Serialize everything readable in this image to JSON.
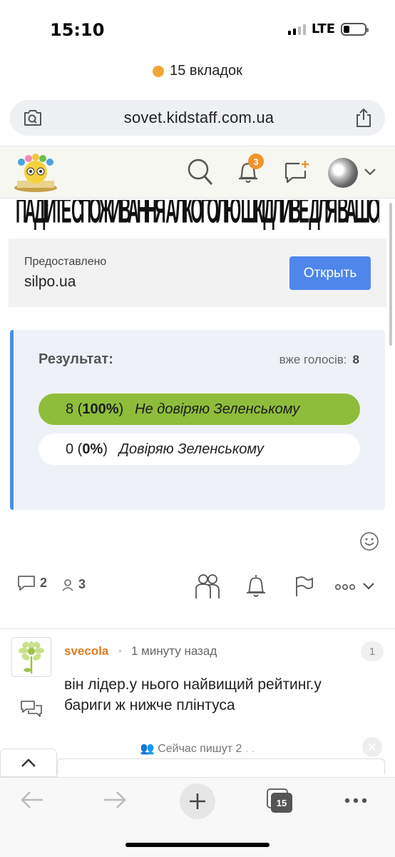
{
  "status_bar": {
    "time": "15:10",
    "network": "LTE"
  },
  "browser": {
    "tab_count_text": "15 вкладок",
    "url": "sovet.kidstaff.com.ua",
    "tabs_badge": "15"
  },
  "header": {
    "notifications_badge": "3"
  },
  "ad": {
    "banner_text": "ПАДІЙТЕ СПОЖИВАННЯ АЛКОГОЛЮ ШКІДЛИВЕ ДЛЯ ВАШОГО ЗДОРОВ'Я",
    "provided_label": "Предоставлено",
    "site": "silpo.ua",
    "open_label": "Открыть"
  },
  "poll": {
    "title": "Результат:",
    "votes_label": "вже голосів:",
    "votes_count": "8",
    "options": [
      {
        "count": "8",
        "percent": "100%",
        "label": "Не довіряю Зеленському",
        "fraction": 1.0
      },
      {
        "count": "0",
        "percent": "0%",
        "label": "Довіряю Зеленському",
        "fraction": 0.0
      }
    ]
  },
  "actions": {
    "comments_count": "2",
    "participants_count": "3"
  },
  "comment": {
    "author": "svecola",
    "dot": "•",
    "time": "1 минуту назад",
    "number": "1",
    "text": "він лідер.у нього найвищий рейтинг.у бариги ж нижче плінтуса"
  },
  "typing": {
    "label": "Сейчас пишут",
    "count": "2",
    "dots": ". ."
  },
  "colors": {
    "accent_green": "#8ebd3b",
    "poll_border": "#4a8fdc",
    "author": "#e07b1a",
    "button_blue": "#4f86ec",
    "badge_orange": "#f0932b"
  }
}
